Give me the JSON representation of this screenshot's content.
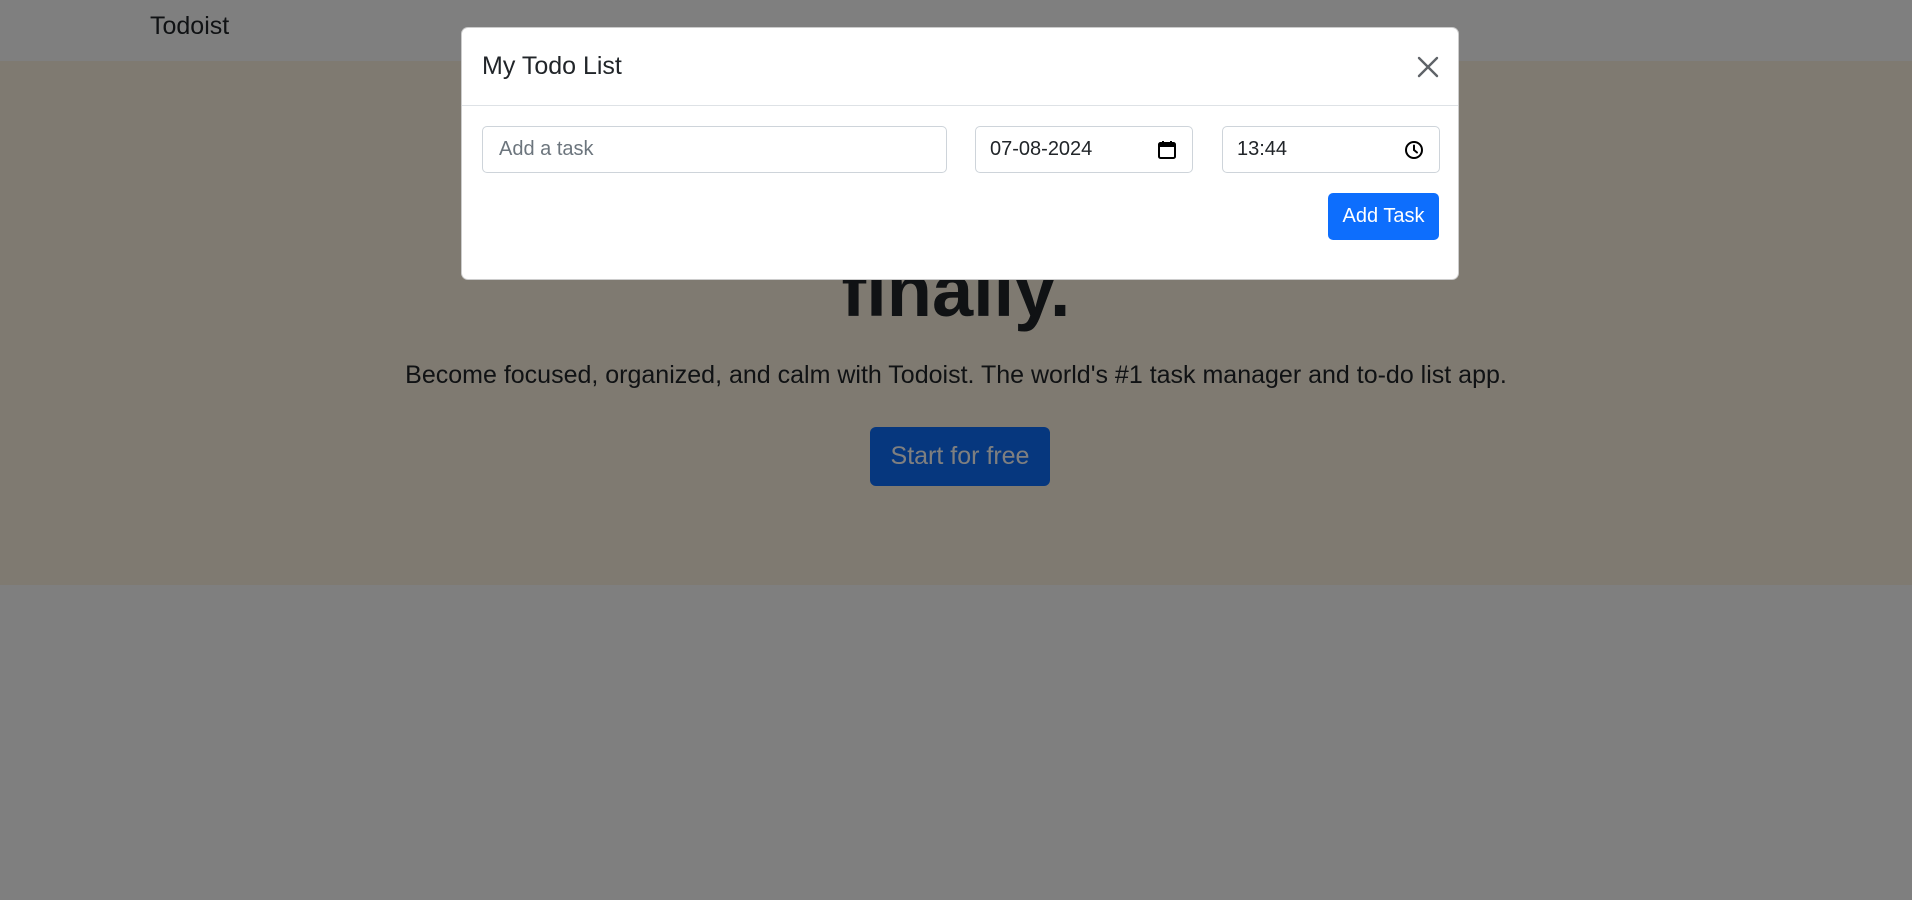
{
  "navbar": {
    "brand": "Todoist"
  },
  "hero": {
    "title": "finally.",
    "subtitle": "Become focused, organized, and calm with Todoist. The world's #1 task manager and to-do list app.",
    "start_button": "Start for free"
  },
  "modal": {
    "title": "My Todo List",
    "close_icon": "close-icon",
    "task_input": {
      "placeholder": "Add a task",
      "value": ""
    },
    "date_field": {
      "value": "07-08-2024",
      "icon": "calendar-icon"
    },
    "time_field": {
      "value": "13:44",
      "icon": "clock-icon"
    },
    "add_button": "Add Task"
  },
  "colors": {
    "primary": "#0d6efd",
    "hero_background": "#fff5e3",
    "backdrop": "rgba(0,0,0,0.5)"
  }
}
